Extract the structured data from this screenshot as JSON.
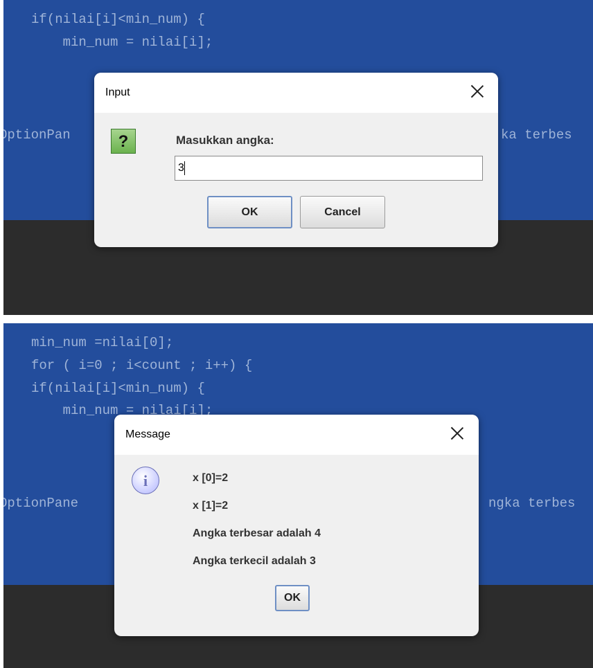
{
  "top_screen": {
    "code_lines": [
      "if(nilai[i]<min_num) {",
      "    min_num = nilai[i];"
    ],
    "code_left_fragment": "OptionPan",
    "code_right_fragment": "ka terbes",
    "dialog": {
      "title": "Input",
      "prompt": "Masukkan angka:",
      "input_value": "3",
      "ok_label": "OK",
      "cancel_label": "Cancel"
    }
  },
  "bottom_screen": {
    "code_lines": [
      "min_num =nilai[0];",
      "for ( i=0 ; i<count ; i++) {",
      "if(nilai[i]<min_num) {",
      "    min_num = nilai[i];"
    ],
    "code_left_fragment": "OptionPane",
    "code_right_fragment": "ngka terbes",
    "dialog": {
      "title": "Message",
      "lines": [
        "x [0]=2",
        "x [1]=2",
        "Angka terbesar adalah 4",
        "Angka terkecil adalah 3"
      ],
      "ok_label": "OK"
    }
  },
  "colors": {
    "editor_blue": "#234d9c",
    "editor_dark": "#2c2c2c",
    "code_text": "#9fb4d8",
    "dialog_bg": "#f0f0f0"
  },
  "icons": {
    "question": "?",
    "info": "i"
  }
}
